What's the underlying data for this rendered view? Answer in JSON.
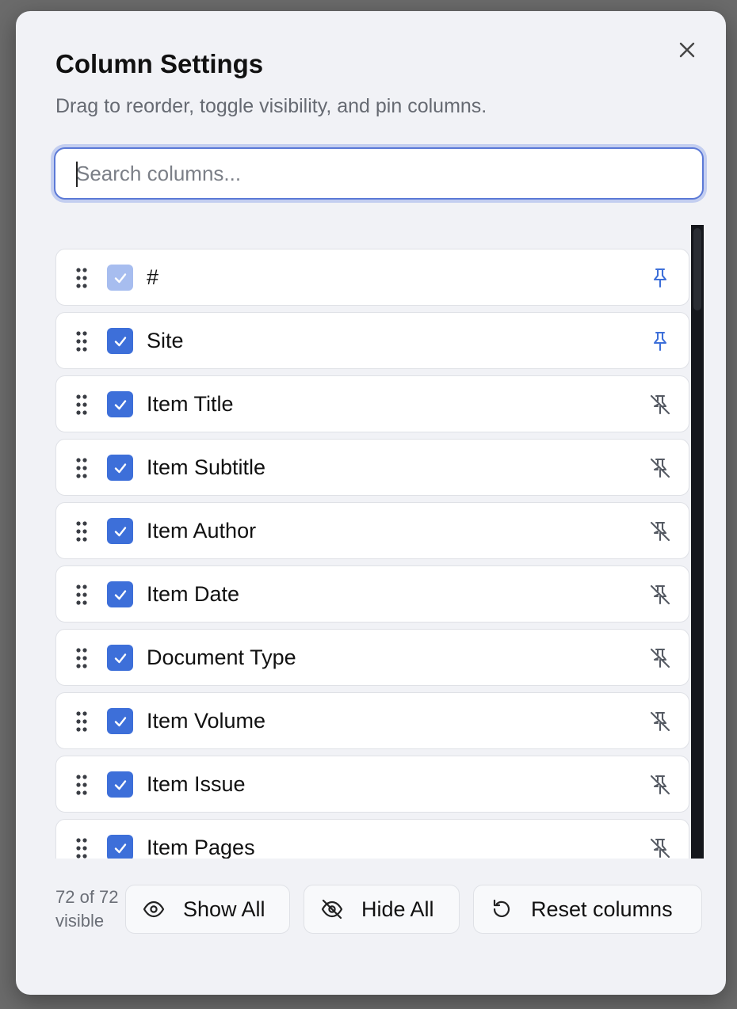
{
  "dialog": {
    "title": "Column Settings",
    "subtitle": "Drag to reorder, toggle visibility, and pin columns.",
    "close_icon": "close-icon"
  },
  "search": {
    "placeholder": "Search columns...",
    "value": ""
  },
  "columns": [
    {
      "label": "#",
      "checked": true,
      "disabled": true,
      "pinned": true
    },
    {
      "label": "Site",
      "checked": true,
      "disabled": false,
      "pinned": true
    },
    {
      "label": "Item Title",
      "checked": true,
      "disabled": false,
      "pinned": false
    },
    {
      "label": "Item Subtitle",
      "checked": true,
      "disabled": false,
      "pinned": false
    },
    {
      "label": "Item Author",
      "checked": true,
      "disabled": false,
      "pinned": false
    },
    {
      "label": "Item Date",
      "checked": true,
      "disabled": false,
      "pinned": false
    },
    {
      "label": "Document Type",
      "checked": true,
      "disabled": false,
      "pinned": false
    },
    {
      "label": "Item Volume",
      "checked": true,
      "disabled": false,
      "pinned": false
    },
    {
      "label": "Item Issue",
      "checked": true,
      "disabled": false,
      "pinned": false
    },
    {
      "label": "Item Pages",
      "checked": true,
      "disabled": false,
      "pinned": false
    }
  ],
  "footer": {
    "count_text": "72 of 72 visible",
    "show_all_label": "Show All",
    "hide_all_label": "Hide All",
    "reset_label": "Reset columns"
  },
  "colors": {
    "accent": "#3d6fd9",
    "accent_disabled": "#a7bdef",
    "pin_active": "#3d6fd9",
    "pin_inactive": "#555a63"
  }
}
